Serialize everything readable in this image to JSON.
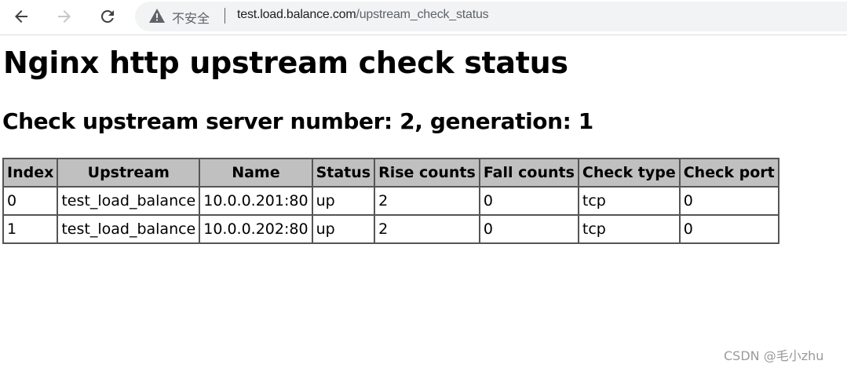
{
  "browser": {
    "security_label": "不安全",
    "url_host": "test.load.balance.com",
    "url_path": "/upstream_check_status"
  },
  "page": {
    "title": "Nginx http upstream check status",
    "subtitle": "Check upstream server number: 2, generation: 1"
  },
  "table": {
    "headers": [
      "Index",
      "Upstream",
      "Name",
      "Status",
      "Rise counts",
      "Fall counts",
      "Check type",
      "Check port"
    ],
    "rows": [
      [
        "0",
        "test_load_balance",
        "10.0.0.201:80",
        "up",
        "2",
        "0",
        "tcp",
        "0"
      ],
      [
        "1",
        "test_load_balance",
        "10.0.0.202:80",
        "up",
        "2",
        "0",
        "tcp",
        "0"
      ]
    ]
  },
  "watermark": "CSDN @毛小zhu",
  "icons": {
    "back": "arrow-left-icon",
    "forward": "arrow-right-icon",
    "reload": "reload-icon",
    "warning": "warning-triangle-icon"
  },
  "colors": {
    "header_bg": "#c0c0c0",
    "border": "#555555",
    "omnibox_bg": "#f1f3f4"
  }
}
